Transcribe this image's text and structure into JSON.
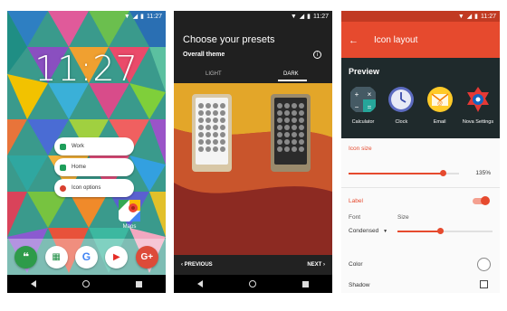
{
  "status_time": "11:27",
  "home": {
    "clock": "11:27",
    "shortcuts": [
      "Work",
      "Home",
      "Icon options"
    ],
    "maps_label": "Maps"
  },
  "presets": {
    "title": "Choose your presets",
    "subtitle": "Overall theme",
    "tab_light": "LIGHT",
    "tab_dark": "DARK",
    "previous": "PREVIOUS",
    "next": "NEXT"
  },
  "icon_layout": {
    "title": "Icon layout",
    "preview_title": "Preview",
    "preview_apps": [
      "Calculator",
      "Clock",
      "Email",
      "Nova Settings"
    ],
    "icon_size_label": "Icon size",
    "icon_size_value": "135%",
    "icon_size_fraction": 0.86,
    "label_title": "Label",
    "label_enabled": true,
    "font_label": "Font",
    "font_value": "Condensed",
    "size_label": "Size",
    "size_fraction": 0.45,
    "color_label": "Color",
    "shadow_label": "Shadow",
    "accent_color": "#e64a2e"
  }
}
